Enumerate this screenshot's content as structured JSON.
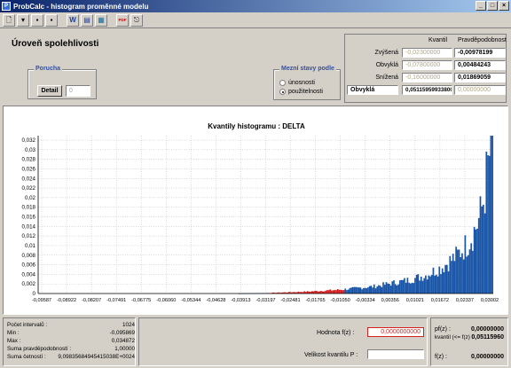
{
  "window": {
    "title": "ProbCalc - histogram proměnné modelu",
    "minimize": "_",
    "maximize": "□",
    "close": "×"
  },
  "toolbar": {
    "items": [
      "new-icon",
      "open-icon",
      "save-icon",
      "word-icon",
      "save-as-icon",
      "table-icon",
      "pdf-icon",
      "exit-icon"
    ],
    "new_glyph": "🗋",
    "open_glyph": "▾",
    "save_glyph": "▪",
    "save2_glyph": "▪",
    "word_glyph": "W",
    "word2_glyph": "▤",
    "table_glyph": "▦",
    "pdf_glyph": "PDF",
    "exit_glyph": "⎋"
  },
  "header": {
    "title": "Úroveň spolehlivosti",
    "failure_group": {
      "title": "Porucha",
      "detail_button": "Detail",
      "detail_value": "0"
    },
    "limit_state_group": {
      "title": "Mezní stavy podle",
      "options": [
        "únosnosti",
        "použitelnosti"
      ],
      "selected": "použitelnosti"
    }
  },
  "quantile_table": {
    "col_quantile": "Kvantil",
    "col_probability": "Pravděpodobnost",
    "rows": [
      {
        "label": "Zvýšená",
        "quantile": "-0,02300000",
        "probability": "-0,00978199"
      },
      {
        "label": "Obvyklá",
        "quantile": "-0,07800000",
        "probability": "0,00484243"
      },
      {
        "label": "Snížená",
        "quantile": "-0,16000000",
        "probability": "0,01869059"
      }
    ],
    "input_row": {
      "label": "Obvyklá",
      "value": "0,05115959933800",
      "result": "0,00000000"
    }
  },
  "chart_data": {
    "type": "bar",
    "title": "Kvantily histogramu : DELTA",
    "x_ticks": [
      "-0,09587",
      "-0,08922",
      "-0,08207",
      "-0,07491",
      "-0,06775",
      "-0,06060",
      "-0,05344",
      "-0,04628",
      "-0,03913",
      "-0,03197",
      "-0,02481",
      "-0,01765",
      "-0,01050",
      "-0,00334",
      "0,00356",
      "0,01021",
      "0,01672",
      "0,02337",
      "0,03002"
    ],
    "y_ticks": [
      "0",
      "0,002",
      "0,004",
      "0,006",
      "0,008",
      "0,01",
      "0,012",
      "0,014",
      "0,016",
      "0,018",
      "0,02",
      "0,022",
      "0,024",
      "0,026",
      "0,028",
      "0,03",
      "0,032"
    ],
    "xlim": [
      -0.0992,
      0.0349
    ],
    "ylim": [
      0,
      0.033
    ],
    "grid": true,
    "highlight_color": "#d42020",
    "bar_color": "#1a56a8",
    "bins_count": 1024,
    "highlight_range": [
      -0.0316,
      -0.0087
    ],
    "density_points": [
      [
        -0.0992,
        0.0
      ],
      [
        -0.04,
        0.0
      ],
      [
        -0.032,
        0.0001
      ],
      [
        -0.02,
        0.0004
      ],
      [
        -0.01,
        0.0008
      ],
      [
        0.0,
        0.0015
      ],
      [
        0.01,
        0.0028
      ],
      [
        0.015,
        0.0038
      ],
      [
        0.02,
        0.0056
      ],
      [
        0.024,
        0.0078
      ],
      [
        0.027,
        0.0102
      ],
      [
        0.029,
        0.0126
      ],
      [
        0.031,
        0.016
      ],
      [
        0.032,
        0.0195
      ],
      [
        0.033,
        0.0245
      ],
      [
        0.034,
        0.03
      ],
      [
        0.0349,
        0.0349
      ]
    ]
  },
  "stats": {
    "rows": [
      {
        "label": "Počet intervalů :",
        "value": "1024"
      },
      {
        "label": "Min :",
        "value": "-0,095869"
      },
      {
        "label": "Max :",
        "value": "0,034872"
      },
      {
        "label": "Suma pravděpodobností :",
        "value": "1,00000"
      },
      {
        "label": "Suma četností :",
        "value": "9,09835684945415038E+0024"
      }
    ]
  },
  "fz_panel": {
    "value_label": "Hodnota f(z) :",
    "value": "0,0000000000",
    "quantile_size_label": "Velikost kvantilu P :",
    "quantile_size": ""
  },
  "result_panel": {
    "pf_label": "pf(z) :",
    "pf_value": "0,00000000",
    "quantile_label": "kvantil (<= f(z) :",
    "quantile_value": "0,05115960",
    "fz_label": "f(z) :",
    "fz_value": "0,00000000"
  }
}
